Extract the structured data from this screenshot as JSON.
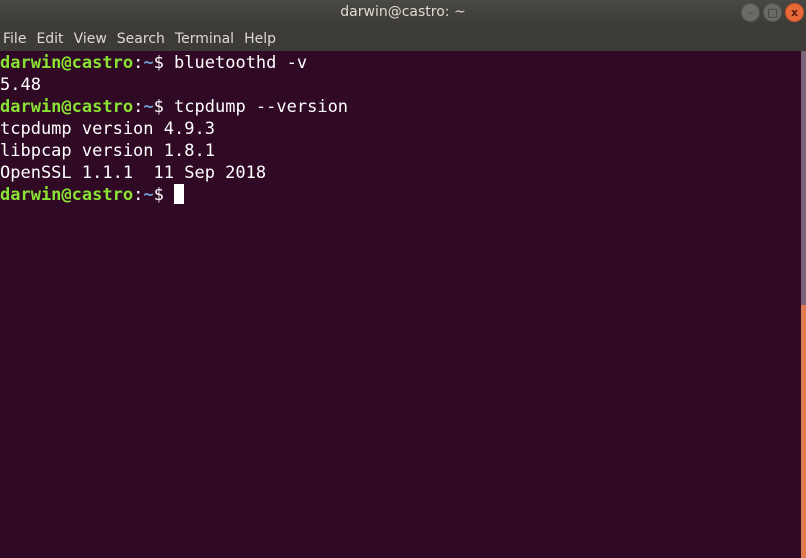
{
  "window": {
    "title": "darwin@castro: ~",
    "controls": [
      {
        "name": "minimize",
        "glyph": "–"
      },
      {
        "name": "maximize",
        "glyph": "□"
      },
      {
        "name": "close",
        "glyph": "x"
      }
    ]
  },
  "menu": {
    "items": [
      "File",
      "Edit",
      "View",
      "Search",
      "Terminal",
      "Help"
    ]
  },
  "terminal": {
    "prompt_user": "darwin@castro",
    "prompt_sep": ":",
    "prompt_path": "~",
    "prompt_symbol": "$ ",
    "lines": [
      {
        "type": "prompt",
        "command": "bluetoothd -v"
      },
      {
        "type": "output",
        "text": "5.48"
      },
      {
        "type": "prompt",
        "command": "tcpdump --version"
      },
      {
        "type": "output",
        "text": "tcpdump version 4.9.3"
      },
      {
        "type": "output",
        "text": "libpcap version 1.8.1"
      },
      {
        "type": "output",
        "text": "OpenSSL 1.1.1  11 Sep 2018"
      },
      {
        "type": "prompt",
        "command": "",
        "cursor": true
      }
    ]
  },
  "scrollbar": {
    "thumb_start_fraction": 0.5,
    "thumb_end_fraction": 1.0
  }
}
